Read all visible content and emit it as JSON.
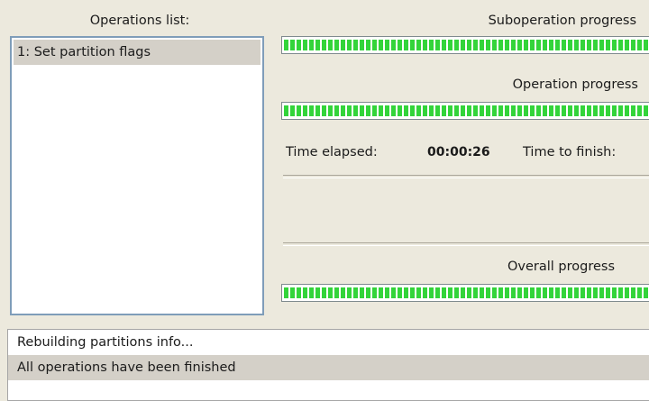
{
  "operations": {
    "title": "Operations list:",
    "items": [
      {
        "label": "1: Set partition flags"
      }
    ]
  },
  "suboperation": {
    "title": "Suboperation progress",
    "progress": 1.0
  },
  "operation": {
    "title": "Operation progress",
    "progress": 1.0
  },
  "timing": {
    "elapsed_label": "Time elapsed:",
    "elapsed_value": "00:00:26",
    "finish_label": "Time to finish:"
  },
  "overall": {
    "title": "Overall progress",
    "progress": 1.0
  },
  "log": {
    "lines": [
      {
        "text": "Rebuilding partitions info..."
      },
      {
        "text": "All operations have been finished"
      }
    ]
  },
  "colors": {
    "progress_fill": "#33d43a",
    "panel_bg": "#ece9dd",
    "selection_bg": "#d4d0c8",
    "list_border": "#7f9db9"
  }
}
